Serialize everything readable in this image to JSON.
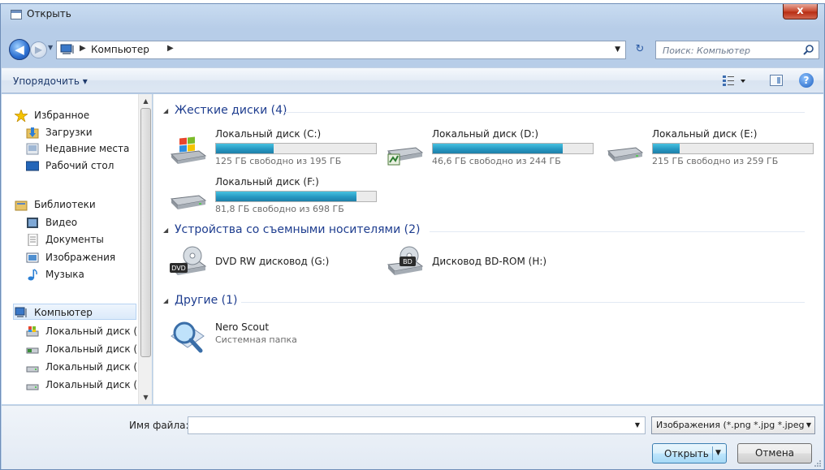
{
  "window": {
    "title": "Открыть",
    "close_symbol": "x"
  },
  "navigation": {
    "back_symbol": "◀",
    "forward_symbol": "▶",
    "address_path": "Компьютер",
    "refresh_symbol": "↻",
    "search_placeholder": "Поиск: Компьютер"
  },
  "toolbar": {
    "organize_label": "Упорядочить ▾",
    "help_symbol": "?"
  },
  "sidebar": {
    "favorites": {
      "label": "Избранное",
      "icon": "star-icon"
    },
    "favorites_items": [
      {
        "label": "Загрузки",
        "icon": "downloads-folder-icon"
      },
      {
        "label": "Недавние места",
        "icon": "recent-places-icon"
      },
      {
        "label": "Рабочий стол",
        "icon": "desktop-icon"
      }
    ],
    "libraries": {
      "label": "Библиотеки",
      "icon": "libraries-icon"
    },
    "libraries_items": [
      {
        "label": "Видео",
        "icon": "video-icon"
      },
      {
        "label": "Документы",
        "icon": "documents-icon"
      },
      {
        "label": "Изображения",
        "icon": "pictures-icon"
      },
      {
        "label": "Музыка",
        "icon": "music-icon"
      }
    ],
    "computer": {
      "label": "Компьютер",
      "icon": "computer-icon"
    },
    "computer_items": [
      {
        "label": "Локальный диск (C:)",
        "icon": "windows-drive-icon"
      },
      {
        "label": "Локальный диск (D:)",
        "icon": "drive-icon"
      },
      {
        "label": "Локальный диск (E:)",
        "icon": "drive-icon"
      },
      {
        "label": "Локальный диск (F:)",
        "icon": "drive-icon"
      }
    ]
  },
  "groups": {
    "hard_drives": {
      "title": "Жесткие диски (4)",
      "drives": [
        {
          "name": "Локальный диск (C:)",
          "free_text": "125 ГБ свободно из 195 ГБ",
          "used_fraction": 0.36,
          "icon": "windows-drive-icon"
        },
        {
          "name": "Локальный диск (D:)",
          "free_text": "46,6 ГБ свободно из 244 ГБ",
          "used_fraction": 0.81,
          "icon": "drive-icon"
        },
        {
          "name": "Локальный диск (E:)",
          "free_text": "215 ГБ свободно из 259 ГБ",
          "used_fraction": 0.17,
          "icon": "drive-icon"
        },
        {
          "name": "Локальный диск (F:)",
          "free_text": "81,8 ГБ свободно из 698 ГБ",
          "used_fraction": 0.88,
          "icon": "drive-icon"
        }
      ]
    },
    "removable": {
      "title": "Устройства со съемными носителями (2)",
      "devices": [
        {
          "name": "DVD RW дисковод (G:)",
          "badge": "DVD",
          "icon": "dvd-drive-icon"
        },
        {
          "name": "Дисковод BD-ROM (H:)",
          "badge": "BD",
          "icon": "bd-drive-icon"
        }
      ]
    },
    "other": {
      "title": "Другие (1)",
      "items": [
        {
          "name": "Nero Scout",
          "subtitle": "Системная папка",
          "icon": "nero-scout-icon"
        }
      ]
    }
  },
  "footer": {
    "filename_label": "Имя файла:",
    "filename_value": "",
    "filter_label": "Изображения (*.png *.jpg *.jpeg)",
    "open_label": "Открыть",
    "cancel_label": "Отмена"
  },
  "colors": {
    "title_text": "#1e3d8f",
    "bar_fill": "#2698c2",
    "window_frame": "#b9d0ea"
  }
}
